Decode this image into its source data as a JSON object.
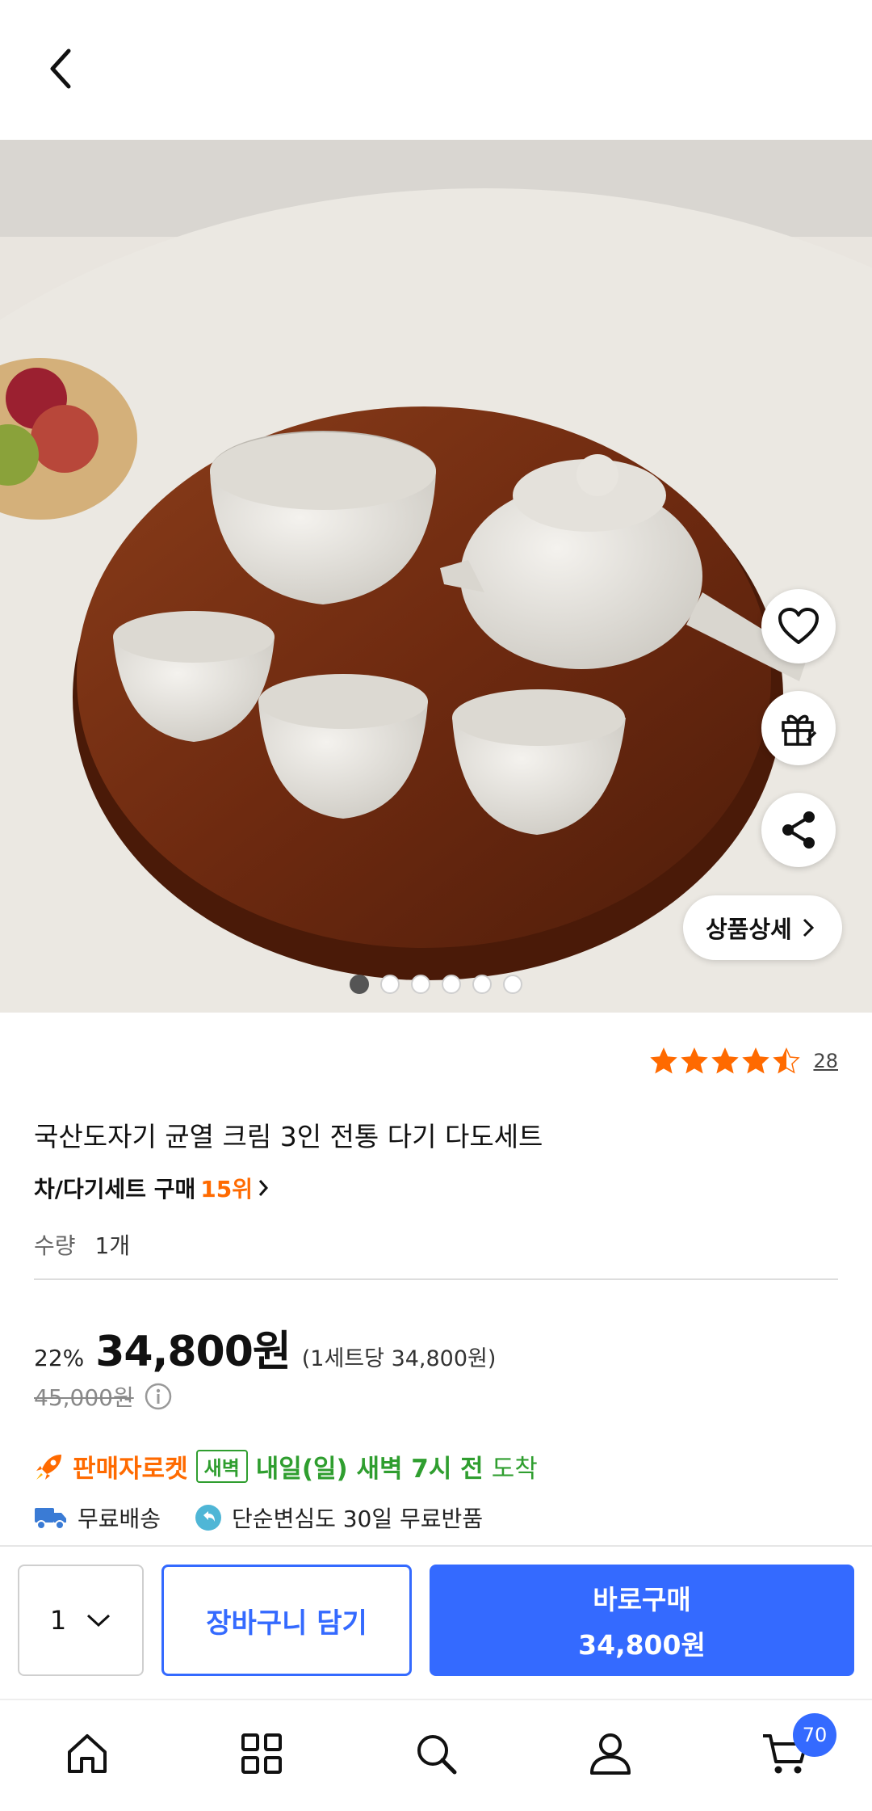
{
  "header": {
    "back_icon": "chevron-left-icon"
  },
  "gallery": {
    "image_count": 6,
    "active_index": 0,
    "detail_button_label": "상품상세"
  },
  "actions": {
    "wishlist_icon": "heart-icon",
    "gift_icon": "gift-icon",
    "share_icon": "share-icon"
  },
  "rating": {
    "stars": 4.5,
    "count": "28"
  },
  "product": {
    "title": "국산도자기 균열 크림 3인 전통 다기 다도세트",
    "category_rank_label": "차/다기세트 구매",
    "category_rank": "15위",
    "quantity_label": "수량",
    "quantity_value": "1개"
  },
  "price": {
    "discount": "22%",
    "sale": "34,800원",
    "unit_price": "(1세트당 34,800원)",
    "original": "45,000원"
  },
  "delivery": {
    "rocket_label": "판매자로켓",
    "dawn_badge": "새벽",
    "arrival": "내일(일) 새벽 7시 전",
    "arrival_suffix": "도착",
    "free_shipping": "무료배송",
    "free_return": "단순변심도 30일 무료반품"
  },
  "buybar": {
    "quantity": "1",
    "cart_button": "장바구니 담기",
    "buy_button": "바로구매",
    "buy_price": "34,800원"
  },
  "tabbar": {
    "cart_count": "70",
    "colors": {
      "accent": "#346aff",
      "orange": "#ff6a00",
      "green": "#2f9e2f"
    }
  }
}
